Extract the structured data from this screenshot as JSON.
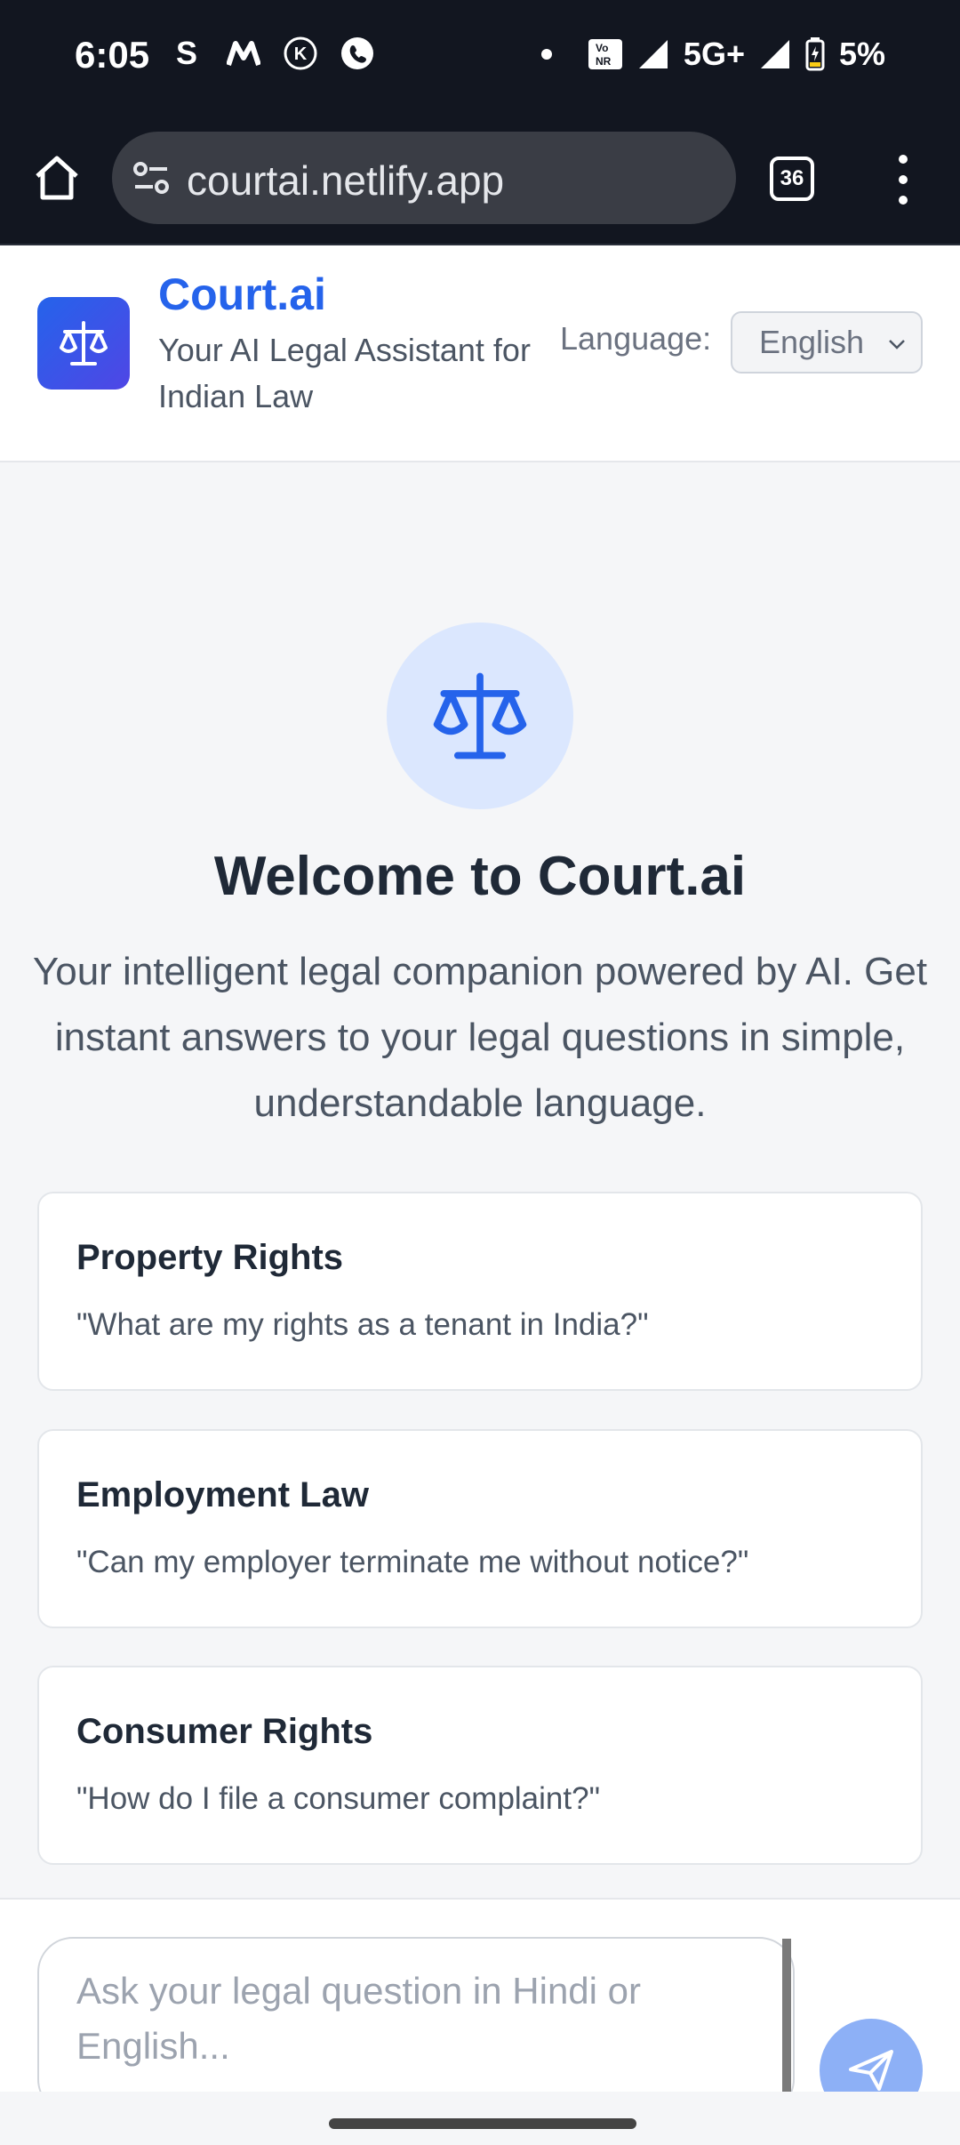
{
  "status_bar": {
    "time": "6:05",
    "app_icons": [
      "skype-icon",
      "myntra-icon",
      "k-icon",
      "phone-call-icon"
    ],
    "network": "5G+",
    "battery": "5%"
  },
  "browser": {
    "url": "courtai.netlify.app",
    "tab_count": "36"
  },
  "header": {
    "title": "Court.ai",
    "subtitle": "Your AI Legal Assistant for Indian Law",
    "language_label": "Language:",
    "language_value": "English"
  },
  "welcome": {
    "title": "Welcome to Court.ai",
    "description": "Your intelligent legal companion powered by AI. Get instant answers to your legal questions in simple, understandable language."
  },
  "suggestions": [
    {
      "title": "Property Rights",
      "question": "\"What are my rights as a tenant in India?\""
    },
    {
      "title": "Employment Law",
      "question": "\"Can my employer terminate me without notice?\""
    },
    {
      "title": "Consumer Rights",
      "question": "\"How do I file a consumer complaint?\""
    }
  ],
  "chat": {
    "placeholder": "Ask your legal question in Hindi or English..."
  },
  "colors": {
    "brand": "#2563eb",
    "status_bar_bg": "#121620",
    "page_bg": "#f5f6f8",
    "send_button": "#8db0f6"
  }
}
